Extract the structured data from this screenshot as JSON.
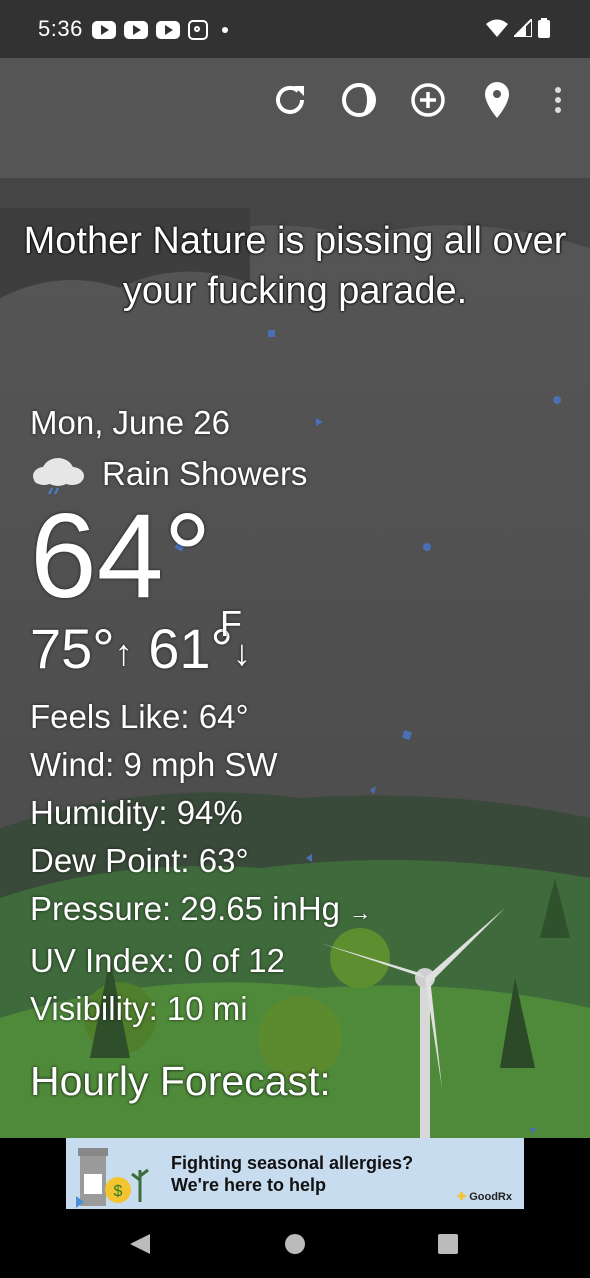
{
  "status_bar": {
    "time": "5:36",
    "notification_icons": [
      "youtube-icon",
      "youtube-icon",
      "youtube-icon",
      "instagram-icon",
      "dot-icon"
    ],
    "system_icons": [
      "wifi-icon",
      "signal-icon",
      "battery-icon"
    ]
  },
  "toolbar": {
    "icons": [
      "refresh-icon",
      "theme-icon",
      "add-location-icon",
      "location-pin-icon",
      "more-vert-icon"
    ]
  },
  "slogan": "Mother Nature is pissing all over your fucking parade.",
  "weather": {
    "date": "Mon, June 26",
    "condition": "Rain Showers",
    "condition_icon": "rain-cloud-icon",
    "temperature": "64°",
    "unit": "F",
    "high": "75°",
    "low": "61°",
    "details": {
      "feels_like": "Feels Like:  64°",
      "wind": "Wind:  9 mph SW",
      "humidity": "Humidity:  94%",
      "dew_point": "Dew Point:  63°",
      "pressure": "Pressure:  29.65 inHg",
      "pressure_trend": "→",
      "uv_index": "UV Index:  0 of 12",
      "visibility": "Visibility:  10 mi"
    },
    "hourly_heading": "Hourly Forecast:"
  },
  "ad": {
    "line1": "Fighting seasonal allergies?",
    "line2": "We're here to help",
    "brand": "GoodRx"
  },
  "colors": {
    "status_bar": "#323232",
    "sky": "#555555",
    "hills": "#3c7a3a",
    "ad_background": "#c8dcf0",
    "rain": "#4a6fb5"
  }
}
